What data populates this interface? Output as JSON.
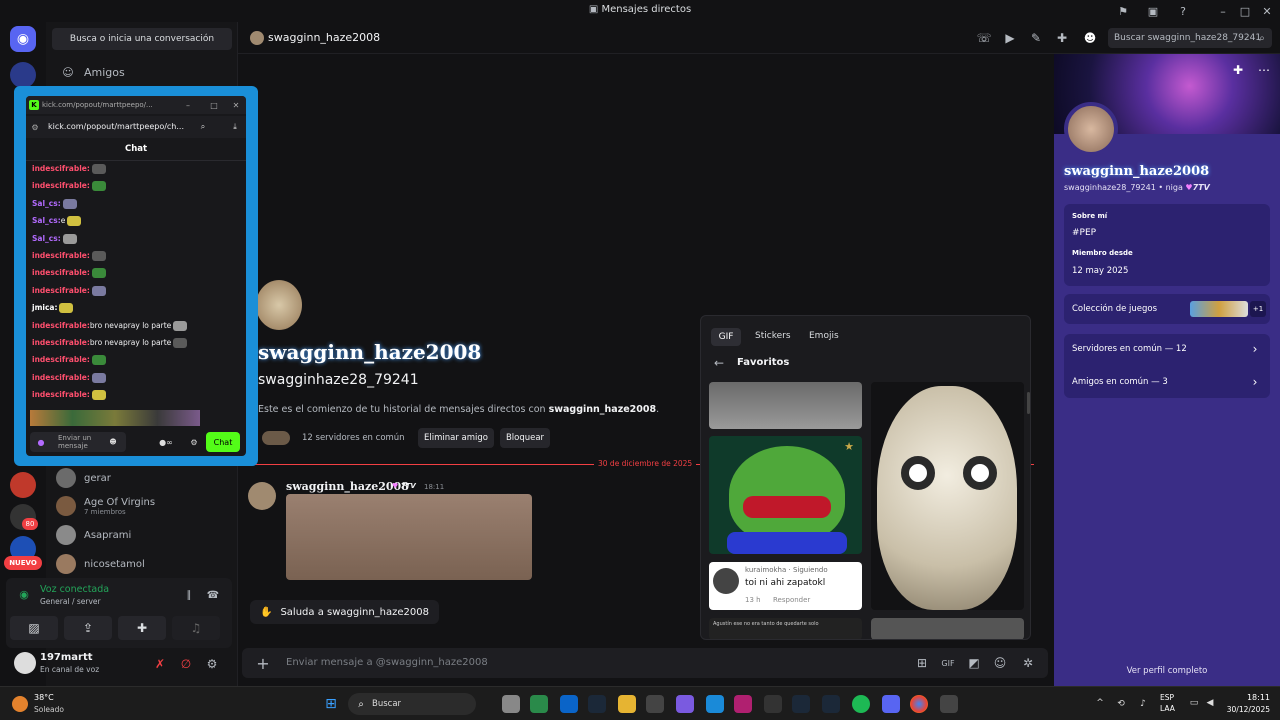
{
  "window": {
    "title": "Mensajes directos"
  },
  "sidebar": {
    "search_label": "Busca o inicia una conversación",
    "friends_label": "Amigos",
    "dm_list": [
      {
        "name": "gerar",
        "sub": ""
      },
      {
        "name": "Age Of Virgins",
        "sub": "7 miembros"
      },
      {
        "name": "Asaprami",
        "sub": ""
      },
      {
        "name": "nicosetamol",
        "sub": ""
      }
    ],
    "new_badge": "NUEVO",
    "badge_counts": [
      "80"
    ]
  },
  "voice": {
    "status": "Voz conectada",
    "channel": "General / server"
  },
  "user": {
    "name": "197martt",
    "status": "En canal de voz"
  },
  "chat_header": {
    "name": "swagginn_haze2008",
    "search_placeholder": "Buscar swagginn_haze28_79241"
  },
  "popout": {
    "tab_title": "kick.com/popout/marttpeepo/...",
    "url": "kick.com/popout/marttpeepo/ch...",
    "heading": "Chat",
    "messages": [
      {
        "user": "indescifrable:",
        "text": "",
        "cls": "cu1"
      },
      {
        "user": "indescifrable:",
        "text": "",
        "cls": "cu1"
      },
      {
        "user": "Sal_cs:",
        "text": "",
        "cls": "cu2"
      },
      {
        "user": "Sal_cs:",
        "text": "e",
        "cls": "cu2"
      },
      {
        "user": "Sal_cs:",
        "text": "",
        "cls": "cu2"
      },
      {
        "user": "indescifrable:",
        "text": "",
        "cls": "cu1"
      },
      {
        "user": "indescifrable:",
        "text": "",
        "cls": "cu1"
      },
      {
        "user": "indescifrable:",
        "text": "",
        "cls": "cu1"
      },
      {
        "user": "jmica:",
        "text": "",
        "cls": "cw"
      },
      {
        "user": "indescifrable:",
        "text": "bro nevapray lo parte",
        "cls": "cu1"
      },
      {
        "user": "indescifrable:",
        "text": "bro nevapray lo parte",
        "cls": "cu1"
      },
      {
        "user": "indescifrable:",
        "text": "",
        "cls": "cu1"
      },
      {
        "user": "indescifrable:",
        "text": "",
        "cls": "cu1"
      },
      {
        "user": "indescifrable:",
        "text": "",
        "cls": "cu1"
      }
    ],
    "input_placeholder": "Enviar un mensaje",
    "send_label": "Chat"
  },
  "dm_intro": {
    "display_name": "swagginn_haze2008",
    "username": "swagginhaze28_79241",
    "intro_prefix": "Este es el comienzo de tu historial de mensajes directos con ",
    "intro_name": "swagginn_haze2008",
    "intro_suffix": ".",
    "mutual_servers": "12 servidores en común",
    "remove_friend": "Eliminar amigo",
    "block": "Bloquear"
  },
  "divider_date": "30 de diciembre de 2025",
  "message": {
    "author": "swagginn_haze2008",
    "badge": "7TV",
    "time": "18:11"
  },
  "wave_label": "Saluda a swagginn_haze2008",
  "composer_placeholder": "Enviar mensaje a @swagginn_haze2008",
  "gif_picker": {
    "tabs": [
      "GIF",
      "Stickers",
      "Emojis"
    ],
    "section": "Favoritos",
    "comment_user": "kuraimokha · Siguiendo",
    "comment_text": "toi ni ahi zapatokl",
    "comment_time": "13 h",
    "comment_reply": "Responder",
    "small_caption": "Agustín ese no era tanto de quedarte solo"
  },
  "profile": {
    "display_name": "swagginn_haze2008",
    "username_line": "swagginhaze28_79241 • niga",
    "badge": "7TV",
    "about_label": "Sobre mí",
    "about_text": "#PEP",
    "member_since_label": "Miembro desde",
    "member_since": "12 may 2025",
    "games_label": "Colección de juegos",
    "games_more": "+1",
    "servers_label": "Servidores en común — 12",
    "friends_label": "Amigos en común — 3",
    "full_profile": "Ver perfil completo"
  },
  "taskbar": {
    "weather_temp": "38°C",
    "weather_desc": "Soleado",
    "search_label": "Buscar",
    "lang_top": "ESP",
    "lang_bottom": "LAA",
    "time": "18:11",
    "date": "30/12/2025"
  },
  "colors": {
    "accent": "#5865f2",
    "kick_green": "#53fc18",
    "profile_bg": "#3a2d86",
    "divider_red": "#f23f43"
  }
}
